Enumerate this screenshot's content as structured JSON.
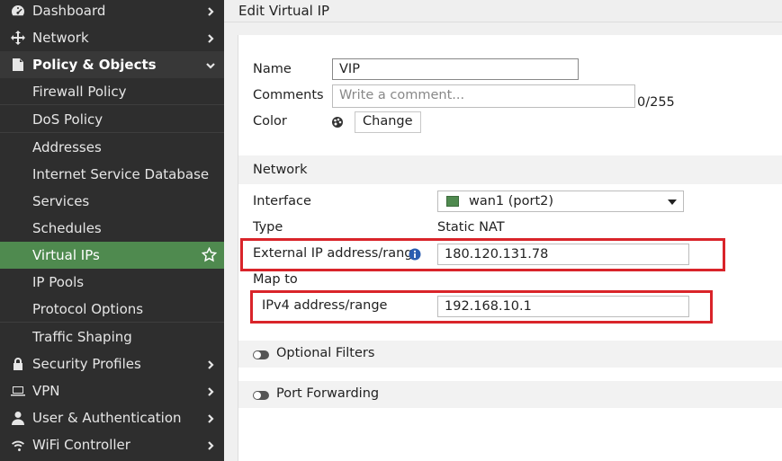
{
  "sidebar": {
    "items": [
      {
        "label": "Dashboard",
        "icon": "dashboard-icon"
      },
      {
        "label": "Network",
        "icon": "network-icon"
      },
      {
        "label": "Policy & Objects",
        "icon": "policy-objects-icon"
      },
      {
        "label": "Firewall Policy"
      },
      {
        "label": "DoS Policy"
      },
      {
        "label": "Addresses"
      },
      {
        "label": "Internet Service Database"
      },
      {
        "label": "Services"
      },
      {
        "label": "Schedules"
      },
      {
        "label": "Virtual IPs"
      },
      {
        "label": "IP Pools"
      },
      {
        "label": "Protocol Options"
      },
      {
        "label": "Traffic Shaping"
      },
      {
        "label": "Security Profiles",
        "icon": "lock-icon"
      },
      {
        "label": "VPN",
        "icon": "laptop-icon"
      },
      {
        "label": "User & Authentication",
        "icon": "user-icon"
      },
      {
        "label": "WiFi Controller",
        "icon": "wifi-icon"
      }
    ]
  },
  "header": {
    "title": "Edit Virtual IP"
  },
  "form": {
    "name_label": "Name",
    "name_value": "VIP",
    "comments_label": "Comments",
    "comments_placeholder": "Write a comment...",
    "comments_count": "0/255",
    "color_label": "Color",
    "color_change": "Change",
    "network_section": "Network",
    "interface_label": "Interface",
    "interface_value": "wan1 (port2)",
    "type_label": "Type",
    "type_value": "Static NAT",
    "external_label": "External IP address/range",
    "external_value": "180.120.131.78",
    "mapto_label": "Map to",
    "ipv4_label": "IPv4 address/range",
    "ipv4_value": "192.168.10.1",
    "optional_filters": "Optional Filters",
    "port_forwarding": "Port Forwarding"
  },
  "colors": {
    "highlight": "#d9242a",
    "active": "#4f8a4f",
    "sidebar": "#2e2e2e"
  }
}
